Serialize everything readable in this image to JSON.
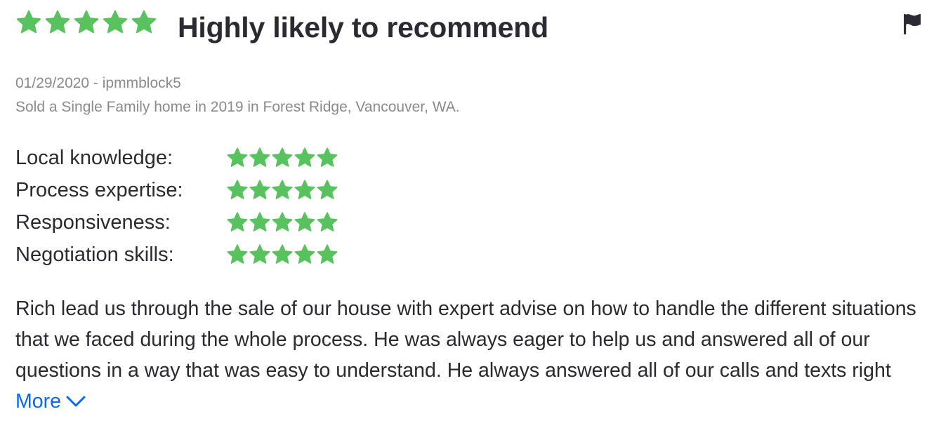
{
  "review": {
    "overall_rating": 5,
    "title": "Highly likely to recommend",
    "flag_icon": "flag-icon",
    "meta_line1": "01/29/2020 - ipmmblock5",
    "meta_line2": "Sold a Single Family home in 2019 in Forest Ridge, Vancouver, WA.",
    "sub_ratings": [
      {
        "label": "Local knowledge:",
        "rating": 5
      },
      {
        "label": "Process expertise:",
        "rating": 5
      },
      {
        "label": "Responsiveness:",
        "rating": 5
      },
      {
        "label": "Negotiation skills:",
        "rating": 5
      }
    ],
    "body": "Rich lead us through the sale of our house with expert advise on how to handle the different situations that we faced during the whole process. He was always eager to help us and answered all of our questions in a way that was easy to understand. He always answered all of our calls and texts right",
    "more_label": "More",
    "more_icon": "chevron-down-icon"
  },
  "colors": {
    "star": "#58c25e",
    "text": "#2a2a33",
    "meta": "#8a8a8e",
    "link": "#006aff"
  }
}
